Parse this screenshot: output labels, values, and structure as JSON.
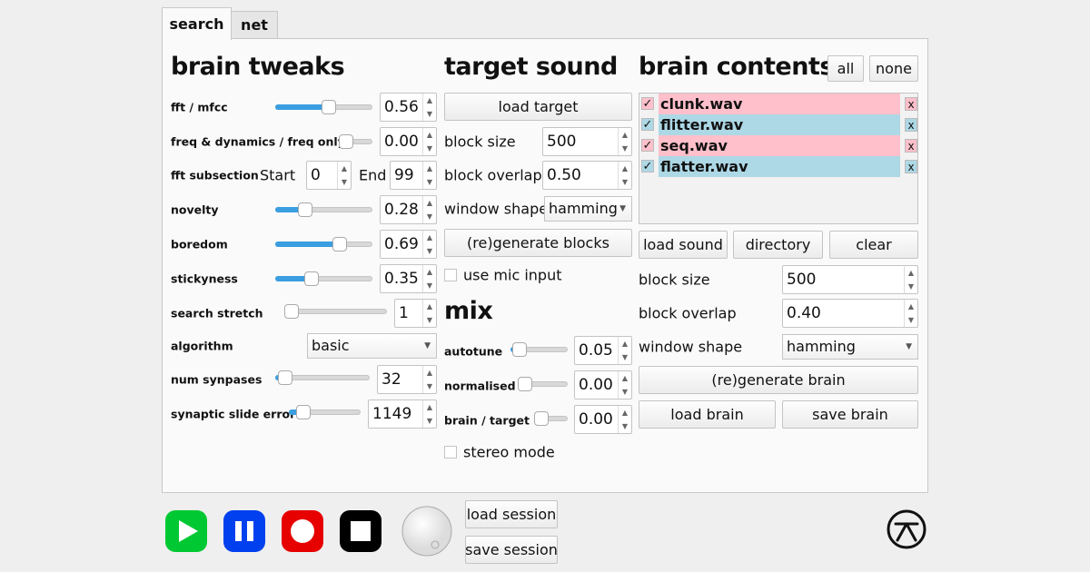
{
  "tabs": [
    {
      "label": "search",
      "active": true
    },
    {
      "label": "net",
      "active": false
    }
  ],
  "brain_tweaks": {
    "title": "brain tweaks",
    "fft_mfcc": {
      "label": "fft / mfcc",
      "value": "0.56",
      "slider_level": 0.56
    },
    "freq_dynamics": {
      "label": "freq & dynamics / freq only",
      "value": "0.00",
      "slider_level": 0.0
    },
    "fft_subsection": {
      "label": "fft subsection",
      "start_label": "Start",
      "start": "0",
      "end_label": "End",
      "end": "99"
    },
    "novelty": {
      "label": "novelty",
      "value": "0.28",
      "slider_level": 0.28
    },
    "boredom": {
      "label": "boredom",
      "value": "0.69",
      "slider_level": 0.69
    },
    "stickyness": {
      "label": "stickyness",
      "value": "0.35",
      "slider_level": 0.35
    },
    "search_stretch": {
      "label": "search stretch",
      "value": "1",
      "slider_level": 0.0
    },
    "algorithm": {
      "label": "algorithm",
      "value": "basic"
    },
    "num_synapses": {
      "label": "num synpases",
      "value": "32",
      "slider_level": 0.03
    },
    "synaptic_slide_error": {
      "label": "synaptic slide error",
      "value": "1149",
      "slider_level": 0.12
    }
  },
  "target_sound": {
    "title": "target sound",
    "load_target": "load target",
    "block_size": {
      "label": "block size",
      "value": "500"
    },
    "block_overlap": {
      "label": "block overlap",
      "value": "0.50"
    },
    "window_shape": {
      "label": "window shape",
      "value": "hamming"
    },
    "regenerate": "(re)generate blocks",
    "use_mic": {
      "label": "use mic input",
      "checked": false
    }
  },
  "mix": {
    "title": "mix",
    "autotune": {
      "label": "autotune",
      "value": "0.05",
      "slider_level": 0.05
    },
    "normalised": {
      "label": "normalised",
      "value": "0.00",
      "slider_level": 0.0
    },
    "brain_target": {
      "label": "brain / target",
      "value": "0.00",
      "slider_level": 0.0
    },
    "stereo_mode": {
      "label": "stereo mode",
      "checked": false
    }
  },
  "brain_contents": {
    "title": "brain contents",
    "all": "all",
    "none": "none",
    "items": [
      {
        "name": "clunk.wav",
        "checked": true,
        "color": "#ffc0cb",
        "remove": "x"
      },
      {
        "name": "flitter.wav",
        "checked": true,
        "color": "#add8e6",
        "remove": "x"
      },
      {
        "name": "seq.wav",
        "checked": true,
        "color": "#ffc0cb",
        "remove": "x"
      },
      {
        "name": "flatter.wav",
        "checked": true,
        "color": "#add8e6",
        "remove": "x"
      }
    ],
    "load_sound": "load sound",
    "directory": "directory",
    "clear": "clear",
    "block_size": {
      "label": "block size",
      "value": "500"
    },
    "block_overlap": {
      "label": "block overlap",
      "value": "0.40"
    },
    "window_shape": {
      "label": "window shape",
      "value": "hamming"
    },
    "regenerate": "(re)generate brain",
    "load_brain": "load brain",
    "save_brain": "save brain"
  },
  "transport": {
    "play_color": "#00c832",
    "pause_color": "#0040ee",
    "record_color": "#e60000",
    "stop_color": "#000000",
    "load_session": "load session",
    "save_session": "save session"
  },
  "check_glyph": "✓"
}
